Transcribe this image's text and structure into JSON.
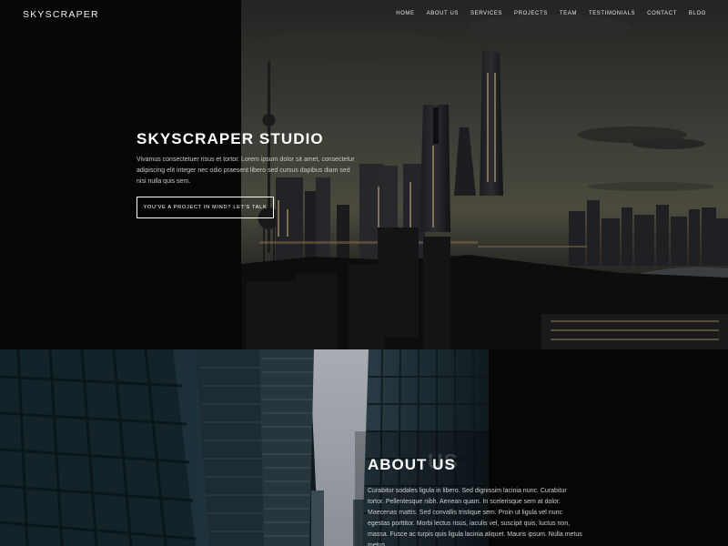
{
  "brand": "SKYSCRAPER",
  "nav": {
    "items": [
      "HOME",
      "ABOUT US",
      "SERVICES",
      "PROJECTS",
      "TEAM",
      "TESTIMONIALS",
      "CONTACT",
      "BLOG"
    ]
  },
  "hero": {
    "title": "SKYSCRAPER STUDIO",
    "body": "Vivamus consectetuer risus et tortor. Lorem ipsum dolor sit amet, consectetur adipiscing elit integer nec odio praesent libero sed cursus dapibus diam sed nisi nulla quis sem.",
    "cta_label": "YOU'VE A PROJECT IN MIND? LET'S TALK"
  },
  "about": {
    "ghost_title": "US",
    "title": "ABOUT US",
    "body": "Curabitur sodales ligula in libero. Sed dignissim lacinia nunc. Curabitur tortor. Pellentesque nibh. Aenean quam. In scelerisque sem at dolor. Maecenas mattis. Sed convallis tristique sem. Proin ut ligula vel nunc egestas porttitor. Morbi lectus risus, iaculis vel, suscipit quis, luctus non, massa. Fusce ac turpis quis ligula lacinia aliquet. Mauris ipsum. Nulla metus metus."
  },
  "colors": {
    "background": "#060606",
    "sky": "#3a3a34",
    "cta_border": "#ffffff",
    "text_muted": "#c9c9c9"
  }
}
